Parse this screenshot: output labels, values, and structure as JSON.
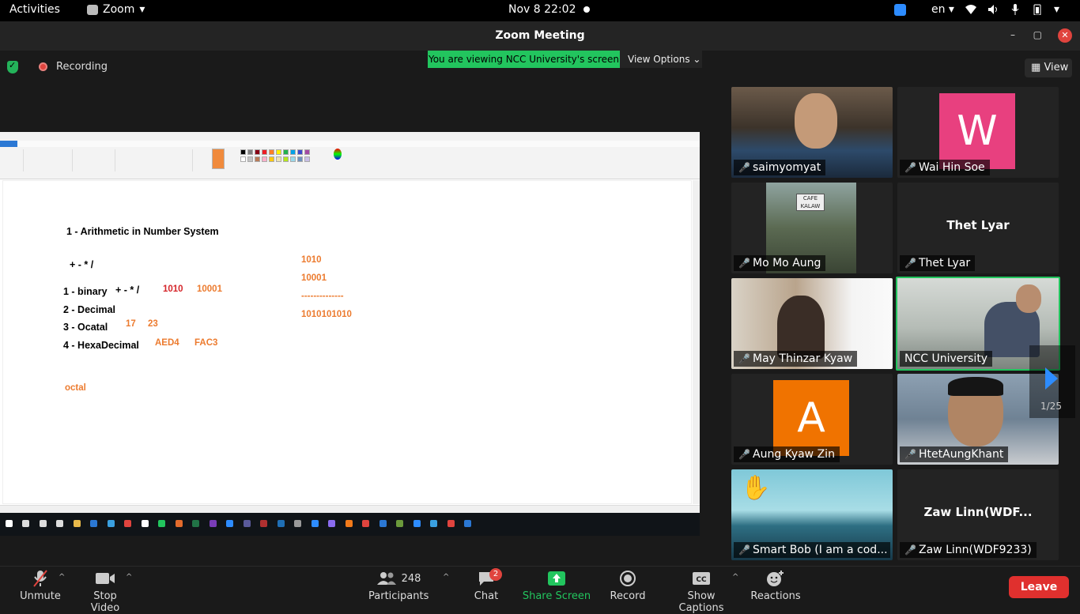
{
  "topbar": {
    "activities": "Activities",
    "app_name": "Zoom",
    "clock": "Nov 8  22:02",
    "language": "en"
  },
  "window": {
    "title": "Zoom Meeting"
  },
  "meeting": {
    "recording_label": "Recording",
    "viewing_banner": "You are viewing NCC University's screen",
    "view_options": "View Options",
    "view_button": "View"
  },
  "shared_screen": {
    "lines": [
      {
        "text": "1 - Arithmetic in Number System"
      },
      {
        "text": "+ - * /"
      },
      {
        "text": "1 - binary"
      },
      {
        "text": "+ - * /"
      },
      {
        "text": "1010"
      },
      {
        "text": "10001"
      },
      {
        "text": "2 - Decimal"
      },
      {
        "text": "3 - Ocatal"
      },
      {
        "text": "17"
      },
      {
        "text": "23"
      },
      {
        "text": "4 - HexaDecimal"
      },
      {
        "text": "AED4"
      },
      {
        "text": "FAC3"
      },
      {
        "text": "octal"
      },
      {
        "text": "1010"
      },
      {
        "text": "10001"
      },
      {
        "text": "--------------"
      },
      {
        "text": "1010101010"
      }
    ]
  },
  "gallery": {
    "participants": [
      {
        "name": "saimyomyat",
        "type": "video"
      },
      {
        "name": "Wai Hin Soe",
        "type": "avatar",
        "initial": "W",
        "color": "#e8407f"
      },
      {
        "name": "Mo Mo Aung",
        "type": "video"
      },
      {
        "name": "Thet Lyar",
        "type": "name",
        "display": "Thet Lyar"
      },
      {
        "name": "May Thinzar Kyaw",
        "type": "video"
      },
      {
        "name": "NCC University",
        "type": "video",
        "active": true
      },
      {
        "name": "Aung Kyaw Zin",
        "type": "avatar",
        "initial": "A",
        "color": "#f07300"
      },
      {
        "name": "HtetAungKhant",
        "type": "video"
      },
      {
        "name": "Smart Bob (I am a cod...",
        "type": "video",
        "hand": "✋"
      },
      {
        "name": "Zaw Linn(WDF9233)",
        "type": "name",
        "display": "Zaw Linn(WDF..."
      }
    ],
    "page_indicator": "1/25"
  },
  "toolbar": {
    "unmute": "Unmute",
    "stop_video": "Stop Video",
    "participants_count": "248",
    "participants": "Participants",
    "chat_badge": "2",
    "chat": "Chat",
    "share_screen": "Share Screen",
    "record": "Record",
    "captions": "Show Captions",
    "reactions": "Reactions",
    "leave": "Leave"
  }
}
